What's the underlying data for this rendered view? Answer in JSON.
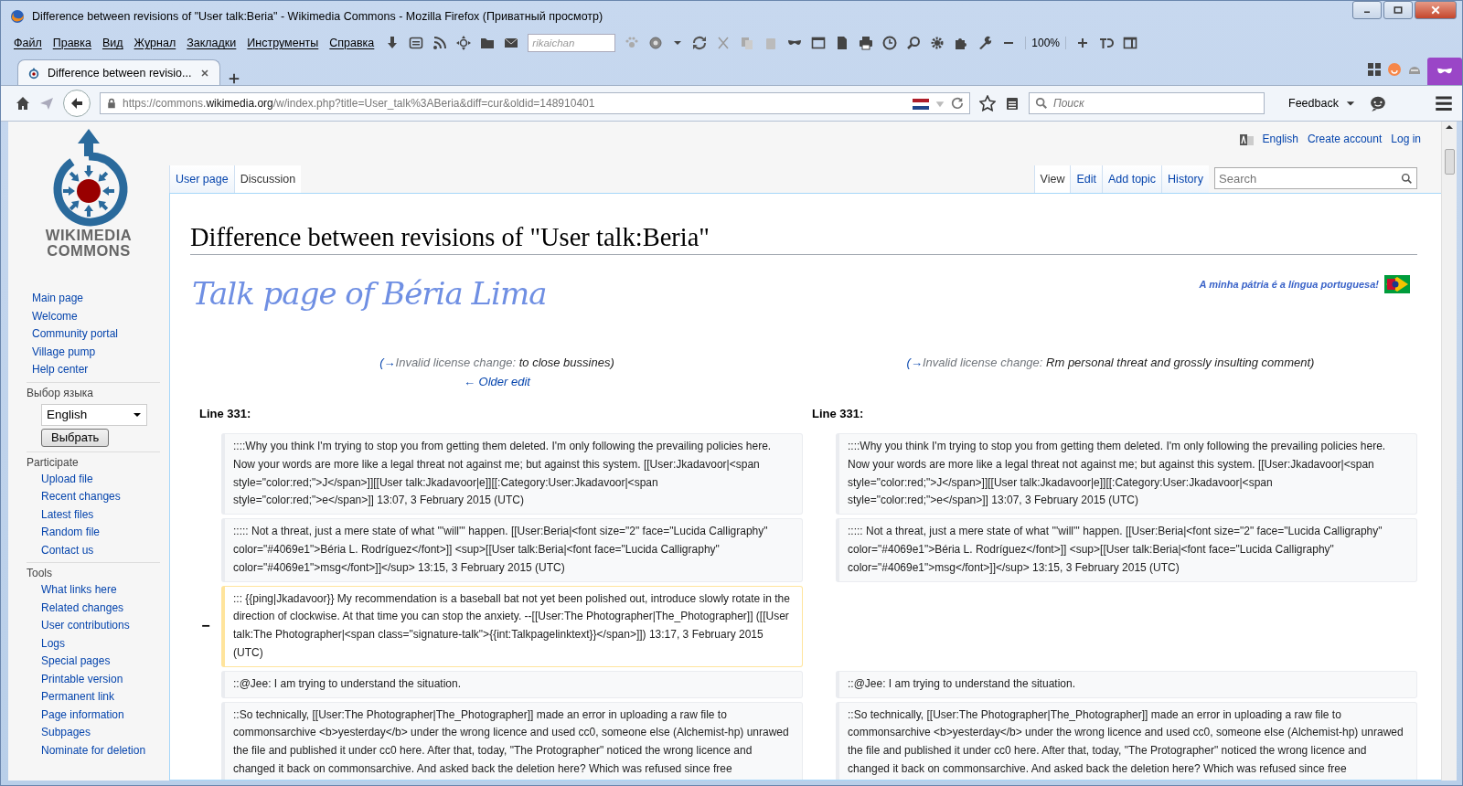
{
  "window": {
    "title": "Difference between revisions of \"User talk:Beria\" - Wikimedia Commons - Mozilla Firefox (Приватный просмотр)"
  },
  "menu": [
    "Файл",
    "Правка",
    "Вид",
    "Журнал",
    "Закладки",
    "Инструменты",
    "Справка"
  ],
  "toolbar": {
    "field": {
      "placeholder": "rikaichan"
    },
    "zoom": "100%"
  },
  "tabs": [
    {
      "title": "Difference between revisio...",
      "selected": true
    }
  ],
  "address_bar": {
    "url": "https://commons.**wikimedia.org**/w/index.php?title=User_talk%3ABeria&diff=cur&oldid=148910401"
  },
  "browser_search": {
    "placeholder": "Поиск"
  },
  "feedback": "Feedback",
  "sidebar": {
    "logo": [
      "WIKIMEDIA",
      "COMMONS"
    ],
    "navigation": [
      "Main page",
      "Welcome",
      "Community portal",
      "Village pump",
      "Help center"
    ],
    "language": {
      "heading": "Выбор языка",
      "value": "English",
      "button": "Выбрать"
    },
    "sections": [
      {
        "heading": "Participate",
        "items": [
          "Upload file",
          "Recent changes",
          "Latest files",
          "Random file",
          "Contact us"
        ]
      },
      {
        "heading": "Tools",
        "items": [
          "What links here",
          "Related changes",
          "User contributions",
          "Logs",
          "Special pages",
          "Printable version",
          "Permanent link",
          "Page information",
          "Subpages",
          "Nominate for deletion"
        ]
      }
    ]
  },
  "personal": [
    "English",
    "Create account",
    "Log in"
  ],
  "namespaces": [
    {
      "label": "User page",
      "selected": false
    },
    {
      "label": "Discussion",
      "selected": true
    }
  ],
  "views": [
    {
      "label": "View",
      "selected": true
    },
    {
      "label": "Edit",
      "selected": false
    },
    {
      "label": "Add topic",
      "selected": false
    },
    {
      "label": "History",
      "selected": false
    }
  ],
  "wiki_search": {
    "placeholder": "Search"
  },
  "heading": "Difference between revisions of \"User talk:Beria\"",
  "banner": {
    "title": "Talk page of Béria Lima",
    "motto": "A minha pátria é a língua portuguesa!"
  },
  "diff": {
    "summaries": [
      {
        "prefix": "(→",
        "section": "Invalid license change:",
        "comment": "to close bussines",
        "suffix": ")"
      },
      {
        "prefix": "(→",
        "section": "Invalid license change:",
        "comment": "Rm personal threat and grossly insulting comment",
        "suffix": ")"
      }
    ],
    "older_edit": "← Older edit",
    "line_labels": [
      "Line 331:",
      "Line 331:"
    ],
    "rows": [
      {
        "kind": "context",
        "left": "::::Why you think I'm trying to stop you from getting them deleted. I'm only following the prevailing policies here. Now your words are more like a legal threat not against me; but against this system. [[User:Jkadavoor|<span style=\"color:red;\">J</span>]][[User talk:Jkadavoor|e]][[:Category:User:Jkadavoor|<span style=\"color:red;\">e</span>]] 13:07, 3 February 2015 (UTC)",
        "right": "::::Why you think I'm trying to stop you from getting them deleted. I'm only following the prevailing policies here. Now your words are more like a legal threat not against me; but against this system. [[User:Jkadavoor|<span style=\"color:red;\">J</span>]][[User talk:Jkadavoor|e]][[:Category:User:Jkadavoor|<span style=\"color:red;\">e</span>]] 13:07, 3 February 2015 (UTC)"
      },
      {
        "kind": "context",
        "left": "::::: Not a threat, just a mere state of what '''will''' happen. [[User:Beria|<font size=\"2\" face=\"Lucida Calligraphy\" color=\"#4069e1\">Béria L. Rodríguez</font>]] <sup>[[User talk:Beria|<font face=\"Lucida Calligraphy\" color=\"#4069e1\">msg</font>]]</sup> 13:15, 3 February 2015 (UTC)",
        "right": "::::: Not a threat, just a mere state of what '''will''' happen. [[User:Beria|<font size=\"2\" face=\"Lucida Calligraphy\" color=\"#4069e1\">Béria L. Rodríguez</font>]] <sup>[[User talk:Beria|<font face=\"Lucida Calligraphy\" color=\"#4069e1\">msg</font>]]</sup> 13:15, 3 February 2015 (UTC)"
      },
      {
        "kind": "deleted",
        "marker": "−",
        "left": "::: {{ping|Jkadavoor}} My recommendation is a baseball bat not yet been polished out, introduce slowly rotate in the direction of clockwise. At that time you can stop the anxiety. --[[User:The Photographer|The_Photographer]] ([[User talk:The Photographer|<span class=\"signature-talk\">{{int:Talkpagelinktext}}</span>]]) 13:17, 3 February 2015 (UTC)"
      },
      {
        "kind": "context",
        "left": "::@Jee: I am trying to understand the situation.",
        "right": "::@Jee: I am trying to understand the situation."
      },
      {
        "kind": "context",
        "left": "::So technically, [[User:The Photographer|The_Photographer]] made an error in uploading a raw file to commonsarchive <b>yesterday</b> under the wrong licence and used cc0, someone else (Alchemist-hp) unrawed the file and published it under cc0 here. After that, today, \"The Protographer\" noticed the wrong licence and changed it back on commonsarchive. And asked back the deletion here? Which was refused since free",
        "right": "::So technically, [[User:The Photographer|The_Photographer]] made an error in uploading a raw file to commonsarchive <b>yesterday</b> under the wrong licence and used cc0, someone else (Alchemist-hp) unrawed the file and published it under cc0 here. After that, today, \"The Protographer\" noticed the wrong licence and changed it back on commonsarchive. And asked back the deletion here? Which was refused since free"
      }
    ]
  }
}
